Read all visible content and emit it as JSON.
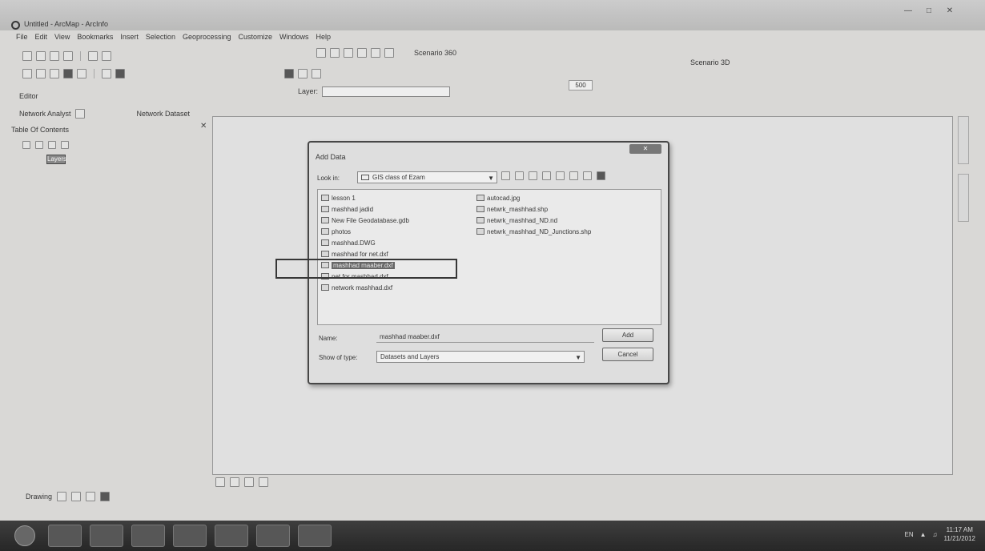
{
  "window": {
    "title": "Untitled - ArcMap - ArcInfo"
  },
  "menu": [
    "File",
    "Edit",
    "View",
    "Bookmarks",
    "Insert",
    "Selection",
    "Geoprocessing",
    "Customize",
    "Windows",
    "Help"
  ],
  "toolbars": {
    "scenario_left": "Scenario 360",
    "scenario_right": "Scenario 3D",
    "editor": "Editor",
    "layer_label": "Layer:",
    "scale_value": "500",
    "network_analyst": "Network Analyst",
    "network_dataset": "Network Dataset"
  },
  "toc": {
    "title": "Table Of Contents",
    "layers_label": "Layers"
  },
  "dialog": {
    "title": "Add Data",
    "look_in_label": "Look in:",
    "look_in_value": "GIS class of Ezam",
    "files_left": [
      "lesson 1",
      "mashhad jadid",
      "New File Geodatabase.gdb",
      "photos",
      "mashhad.DWG",
      "mashhad for net.dxf",
      "mashhad maaber.dxf",
      "net for mashhad.dxf",
      "network mashhad.dxf"
    ],
    "selected_index": 6,
    "files_right": [
      "autocad.jpg",
      "netwrk_mashhad.shp",
      "netwrk_mashhad_ND.nd",
      "netwrk_mashhad_ND_Junctions.shp"
    ],
    "name_label": "Name:",
    "name_value": "mashhad maaber.dxf",
    "type_label": "Show of type:",
    "type_value": "Datasets and Layers",
    "add_label": "Add",
    "cancel_label": "Cancel"
  },
  "drawing": {
    "label": "Drawing"
  },
  "taskbar": {
    "lang": "EN",
    "time": "11:17 AM",
    "date": "11/21/2012"
  }
}
